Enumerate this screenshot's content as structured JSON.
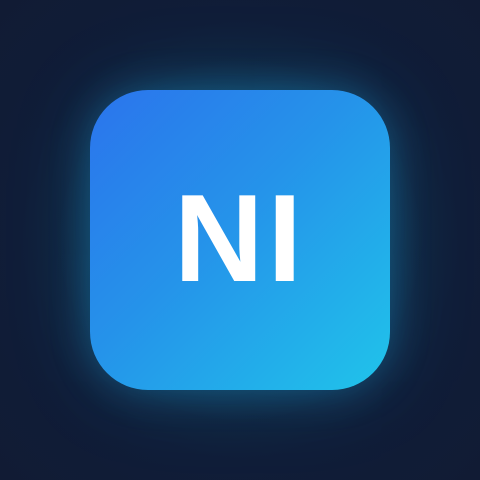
{
  "app_icon": {
    "monogram": "NI",
    "icon_name": "app-monogram-icon",
    "colors": {
      "background_outer": "#111b34",
      "background_center": "#12394f",
      "tile_gradient_start": "#2b74ec",
      "tile_gradient_end": "#20c4ea",
      "text": "#ffffff"
    }
  }
}
